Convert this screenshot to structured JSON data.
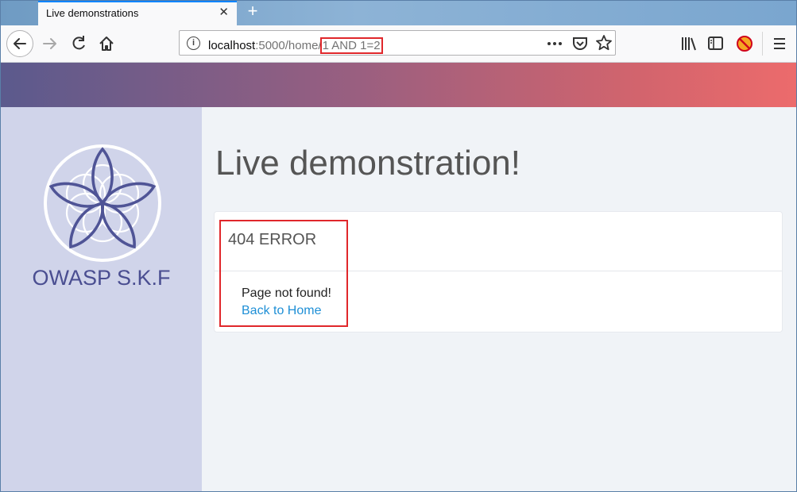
{
  "browser": {
    "tab_title": "Live demonstrations",
    "tab_close": "✕",
    "new_tab": "+",
    "url": {
      "host": "localhost",
      "path": ":5000/home/",
      "injection": "1 AND 1=2"
    },
    "icons": {
      "back": "arrow-left",
      "forward": "arrow-right",
      "reload": "reload",
      "home": "home",
      "info": "info",
      "more": "more-dots",
      "pocket": "pocket",
      "bookmark": "star",
      "library": "library",
      "sidebar": "sidebar",
      "addon": "addon-blocked",
      "menu": "hamburger-menu"
    }
  },
  "sidebar": {
    "brand": "OWASP S.K.F"
  },
  "main": {
    "title": "Live demonstration!",
    "card": {
      "heading": "404 ERROR",
      "message": "Page not found!",
      "link": "Back to Home"
    }
  },
  "colors": {
    "accent_red": "#e0272b",
    "brand_purple": "#4a4e91",
    "link_blue": "#1e8fd6",
    "sidebar_bg": "#d0d4ea"
  }
}
